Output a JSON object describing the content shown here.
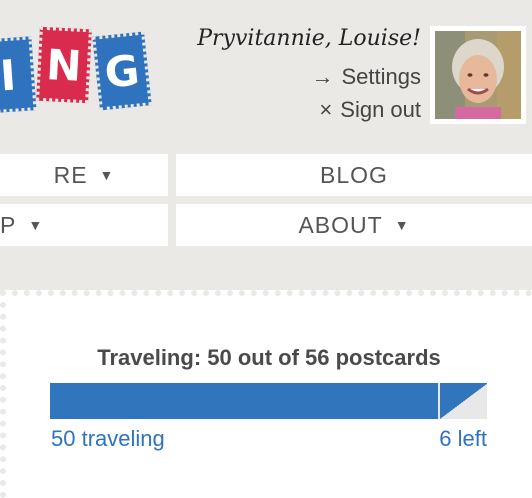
{
  "logo": {
    "letters": [
      "I",
      "N",
      "G"
    ]
  },
  "account": {
    "greeting": "Pryvitannie, Louise!",
    "settings_arrow": "→",
    "settings_label": "Settings",
    "signout_icon": "×",
    "signout_label": "Sign out",
    "avatar_icon": "user-photo"
  },
  "nav": {
    "explore": "RE",
    "blog": "BLOG",
    "app": "P",
    "about": "ABOUT",
    "caret": "▼"
  },
  "progress": {
    "title": "Traveling: 50 out of 56 postcards",
    "traveling_label": "50 traveling",
    "left_label": "6 left",
    "traveling": 50,
    "total": 56,
    "colors": {
      "fill": "#3175bd",
      "track": "#e8e8e8"
    }
  }
}
